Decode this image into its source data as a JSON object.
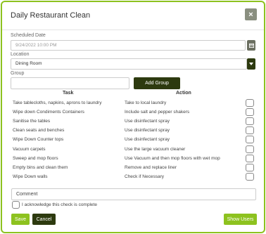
{
  "dialog": {
    "title": "Daily Restaurant Clean",
    "close_label": "×"
  },
  "form": {
    "scheduled_date_label": "Scheduled Date",
    "scheduled_date_value": "9/24/2022 10:00 PM",
    "location_label": "Location",
    "location_value": "Dining Room",
    "group_label": "Group",
    "group_value": "",
    "add_group_label": "Add Group"
  },
  "table": {
    "headers": {
      "task": "Task",
      "action": "Action"
    },
    "rows": [
      {
        "task": "Take tablecloths, napkins, aprons to laundry",
        "action": "Take to local laundry"
      },
      {
        "task": "Wipe down Condiments Containers",
        "action": "Include salt and pepper shakers"
      },
      {
        "task": "Sanitise the tables",
        "action": "Use disinfectant spray"
      },
      {
        "task": "Clean seats and benches",
        "action": "Use disinfectant spray"
      },
      {
        "task": "Wipe Down Counter tops",
        "action": "Use disinfectant spray"
      },
      {
        "task": "Vacuum carpets",
        "action": "Use the large vacuum cleaner"
      },
      {
        "task": "Sweep and mop floors",
        "action": "Use Vacuum and then mop floors with wet mop"
      },
      {
        "task": "Empty bins and clean them",
        "action": "Remove and replace liner"
      },
      {
        "task": "Wipe Down walls",
        "action": "Check if Necessary"
      }
    ]
  },
  "footer": {
    "comment_placeholder": "Comment",
    "acknowledge_label": "I acknowledge this check is complete",
    "save_label": "Save",
    "cancel_label": "Cancel",
    "show_users_label": "Show Users"
  },
  "colors": {
    "accent_green": "#8dc21f",
    "dark_olive": "#2d3a0f",
    "close_gray": "#8a8f80"
  },
  "icons": {
    "calendar": "calendar-icon",
    "dropdown": "chevron-down-icon",
    "close": "close-icon"
  }
}
